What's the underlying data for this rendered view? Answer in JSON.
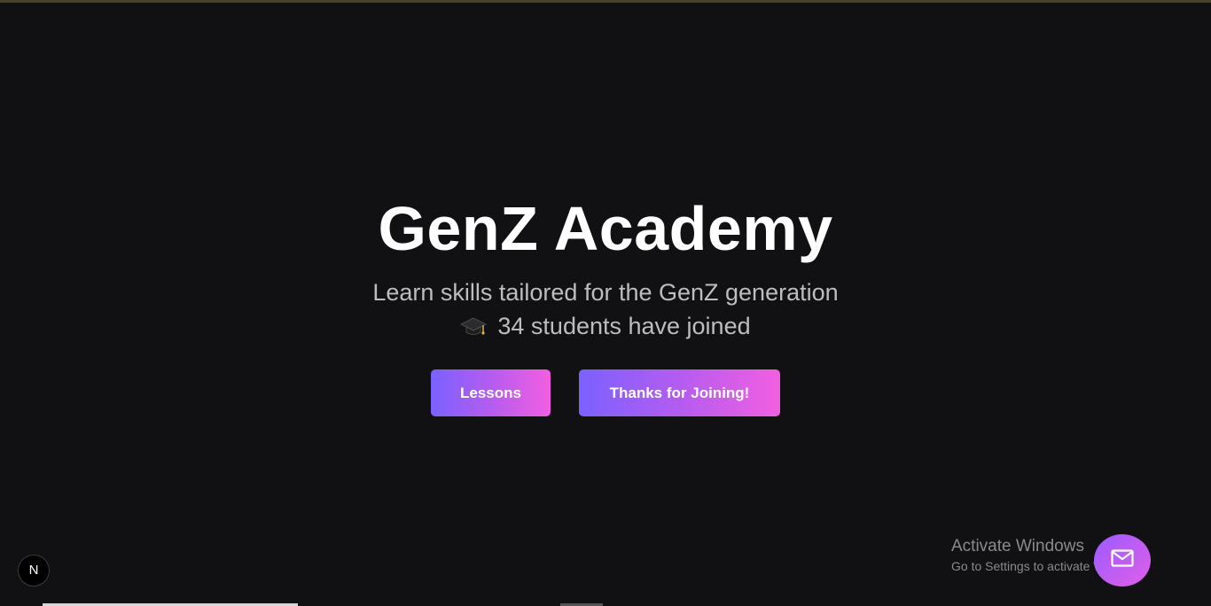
{
  "hero": {
    "title": "GenZ Academy",
    "subtitle": "Learn skills tailored for the GenZ generation",
    "joined_icon": "graduation-cap-icon",
    "joined_text": "34 students have joined",
    "student_count": 34
  },
  "buttons": {
    "lessons_label": "Lessons",
    "joined_label": "Thanks for Joining!"
  },
  "dev_badge": {
    "label": "N"
  },
  "os_watermark": {
    "line1": "Activate Windows",
    "line2": "Go to Settings to activate Windows."
  },
  "fab": {
    "icon": "mail-icon"
  },
  "colors": {
    "background": "#111013",
    "gradient_start": "#7b61ff",
    "gradient_end": "#f25fe0",
    "title": "#ffffff",
    "subtitle": "#bdbdbd"
  }
}
